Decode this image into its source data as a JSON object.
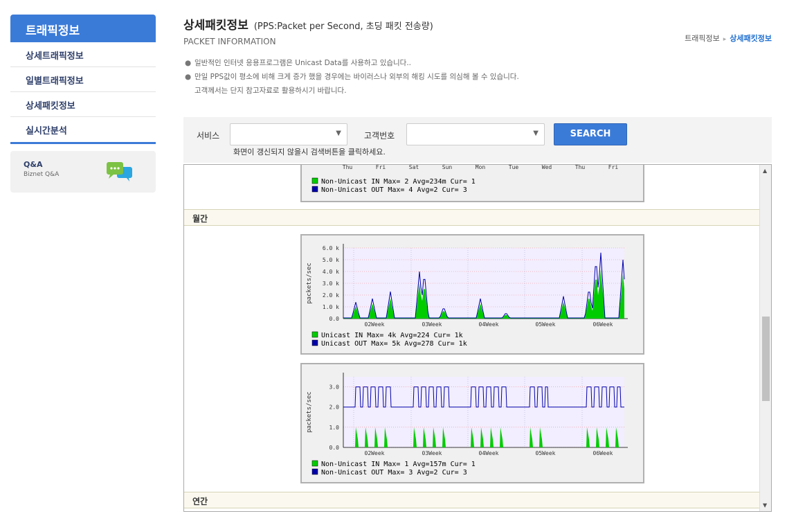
{
  "sidebar": {
    "header": "트래픽정보",
    "items": [
      "상세트래픽정보",
      "일별트래픽정보",
      "상세패킷정보",
      "실시간분석"
    ],
    "qa_title": "Q&A",
    "qa_sub": "Biznet Q&A"
  },
  "page": {
    "title": "상세패킷정보",
    "subtitle": "(PPS:Packet per Second, 초딩 패킷 전송량)",
    "eng": "PACKET INFORMATION",
    "breadcrumb": [
      "트래픽정보",
      "상세패킷정보"
    ],
    "notes": [
      "일반적인 인터넷 응용프로그램은 Unicast Data를 사용하고 있습니다..",
      "만일 PPS값이 평소에 비해 크게 증가 했을 경우에는 바이러스나 외부의 해킹 시도를 의심해 볼 수 있습니다.",
      "고객께서는 단지 참고자료로 활용하시기 바랍니다."
    ]
  },
  "search": {
    "service_label": "서비스",
    "customer_label": "고객번호",
    "service_value": "",
    "customer_value": "",
    "button": "SEARCH",
    "hint": "화면이 갱신되지 않을시 검색버튼을 클릭하세요."
  },
  "sections": {
    "monthly": "월간",
    "yearly": "연간"
  },
  "colors": {
    "accent": "#3b7bd8",
    "in": "#00cc00",
    "out": "#0000aa"
  },
  "weekly_days": [
    "Thu",
    "Fri",
    "Sat",
    "Sun",
    "Mon",
    "Tue",
    "Wed",
    "Thu",
    "Fri"
  ],
  "weekly_legend": [
    {
      "name": "Non-Unicast IN",
      "max": "2",
      "avg": "234m",
      "cur": "1"
    },
    {
      "name": "Non-Unicast OUT",
      "max": "4",
      "avg": "2",
      "cur": "3"
    }
  ],
  "month_unicast_legend": [
    {
      "name": "Unicast IN",
      "max": "4k",
      "avg": "224",
      "cur": "1k"
    },
    {
      "name": "Unicast OUT",
      "max": "5k",
      "avg": "278",
      "cur": "1k"
    }
  ],
  "month_nonunicast_legend": [
    {
      "name": "Non-Unicast IN",
      "max": "1",
      "avg": "157m",
      "cur": "1"
    },
    {
      "name": "Non-Unicast OUT",
      "max": "3",
      "avg": "2",
      "cur": "3"
    }
  ],
  "chart_data": [
    {
      "type": "area",
      "ylabel": "packets/sec",
      "x": [
        "02Week",
        "03Week",
        "04Week",
        "05Week",
        "06Week"
      ],
      "yticks": [
        "0.0",
        "1.0 k",
        "2.0 k",
        "3.0 k",
        "4.0 k",
        "5.0 k",
        "6.0 k"
      ],
      "ylim": [
        0,
        6000
      ],
      "series": [
        {
          "name": "Unicast IN",
          "max": "4k",
          "avg": "224",
          "cur": "1k"
        },
        {
          "name": "Unicast OUT",
          "max": "5k",
          "avg": "278",
          "cur": "1k"
        }
      ]
    },
    {
      "type": "area",
      "ylabel": "packets/sec",
      "x": [
        "02Week",
        "03Week",
        "04Week",
        "05Week",
        "06Week"
      ],
      "yticks": [
        "0.0",
        "1.0",
        "2.0",
        "3.0"
      ],
      "ylim": [
        0,
        3.5
      ],
      "series": [
        {
          "name": "Non-Unicast IN",
          "max": "1",
          "avg": "157m",
          "cur": "1"
        },
        {
          "name": "Non-Unicast OUT",
          "max": "3",
          "avg": "2",
          "cur": "3"
        }
      ]
    }
  ]
}
